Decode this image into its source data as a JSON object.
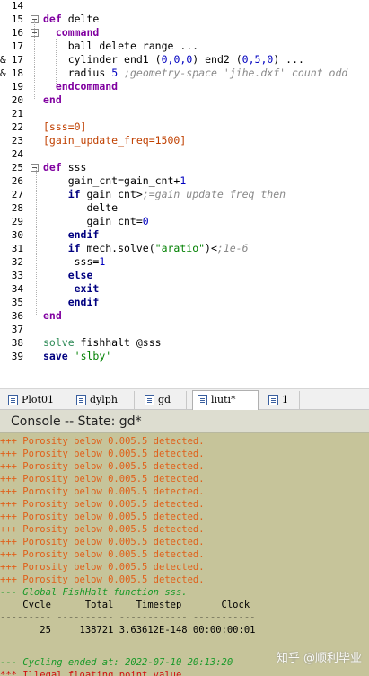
{
  "editor": {
    "lines": [
      {
        "n": "14",
        "a": "",
        "t": ""
      },
      {
        "n": "15",
        "a": "",
        "t": "def delte"
      },
      {
        "n": "16",
        "a": "",
        "t": "  command"
      },
      {
        "n": "17",
        "a": "",
        "t": "    ball delete range ..."
      },
      {
        "n": "17",
        "a": "&",
        "t": "    cylinder end1 (0,0,0) end2 (0,5,0) ..."
      },
      {
        "n": "18",
        "a": "&",
        "t": "    radius 5 ;geometry-space 'jihe.dxf' count odd"
      },
      {
        "n": "19",
        "a": "",
        "t": "  endcommand"
      },
      {
        "n": "20",
        "a": "",
        "t": "end"
      },
      {
        "n": "21",
        "a": "",
        "t": ""
      },
      {
        "n": "22",
        "a": "",
        "t": "[sss=0]"
      },
      {
        "n": "23",
        "a": "",
        "t": "[gain_update_freq=1500]"
      },
      {
        "n": "24",
        "a": "",
        "t": ""
      },
      {
        "n": "25",
        "a": "",
        "t": "def sss"
      },
      {
        "n": "26",
        "a": "",
        "t": "    gain_cnt=gain_cnt+1"
      },
      {
        "n": "27",
        "a": "",
        "t": "    if gain_cnt>=gain_update_freq then"
      },
      {
        "n": "28",
        "a": "",
        "t": "       delte"
      },
      {
        "n": "29",
        "a": "",
        "t": "       gain_cnt=0"
      },
      {
        "n": "30",
        "a": "",
        "t": "    endif"
      },
      {
        "n": "31",
        "a": "",
        "t": "    if mech.solve(\"aratio\")<1e-6"
      },
      {
        "n": "32",
        "a": "",
        "t": "     sss=1"
      },
      {
        "n": "33",
        "a": "",
        "t": "    else"
      },
      {
        "n": "34",
        "a": "",
        "t": "     exit"
      },
      {
        "n": "35",
        "a": "",
        "t": "    endif"
      },
      {
        "n": "36",
        "a": "",
        "t": "end"
      },
      {
        "n": "37",
        "a": "",
        "t": ""
      },
      {
        "n": "38",
        "a": "",
        "t": "solve fishhalt @sss"
      },
      {
        "n": "39",
        "a": "",
        "t": "save 'slby'"
      }
    ]
  },
  "tabs": [
    {
      "label": "Plot01",
      "active": false
    },
    {
      "label": "dylph",
      "active": false
    },
    {
      "label": "gd",
      "active": false
    },
    {
      "label": "liuti*",
      "active": true
    },
    {
      "label": "1",
      "active": false
    }
  ],
  "console": {
    "title": "Console -- State: gd*",
    "lines": [
      {
        "cls": "warn",
        "t": "+++ Porosity below 0.005.5 detected."
      },
      {
        "cls": "warn",
        "t": "+++ Porosity below 0.005.5 detected."
      },
      {
        "cls": "warn",
        "t": "+++ Porosity below 0.005.5 detected."
      },
      {
        "cls": "warn",
        "t": "+++ Porosity below 0.005.5 detected."
      },
      {
        "cls": "warn",
        "t": "+++ Porosity below 0.005.5 detected."
      },
      {
        "cls": "warn",
        "t": "+++ Porosity below 0.005.5 detected."
      },
      {
        "cls": "warn",
        "t": "+++ Porosity below 0.005.5 detected."
      },
      {
        "cls": "warn",
        "t": "+++ Porosity below 0.005.5 detected."
      },
      {
        "cls": "warn",
        "t": "+++ Porosity below 0.005.5 detected."
      },
      {
        "cls": "warn",
        "t": "+++ Porosity below 0.005.5 detected."
      },
      {
        "cls": "warn",
        "t": "+++ Porosity below 0.005.5 detected."
      },
      {
        "cls": "warn",
        "t": "+++ Porosity below 0.005.5 detected."
      },
      {
        "cls": "info",
        "t": "--- Global FishHalt function sss."
      },
      {
        "cls": "plain",
        "t": "    Cycle      Total    Timestep       Clock"
      },
      {
        "cls": "plain",
        "t": "--------- ---------- ------------ -----------"
      },
      {
        "cls": "plain",
        "t": "       25     138721 3.63612E-148 00:00:00:01"
      },
      {
        "cls": "plain",
        "t": ""
      },
      {
        "cls": "info",
        "t": "--- Cycling ended at: 2022-07-10 20:13:20"
      },
      {
        "cls": "err",
        "t": "*** Illegal floating point value."
      }
    ],
    "watermark": "知乎 @顺利毕业"
  }
}
